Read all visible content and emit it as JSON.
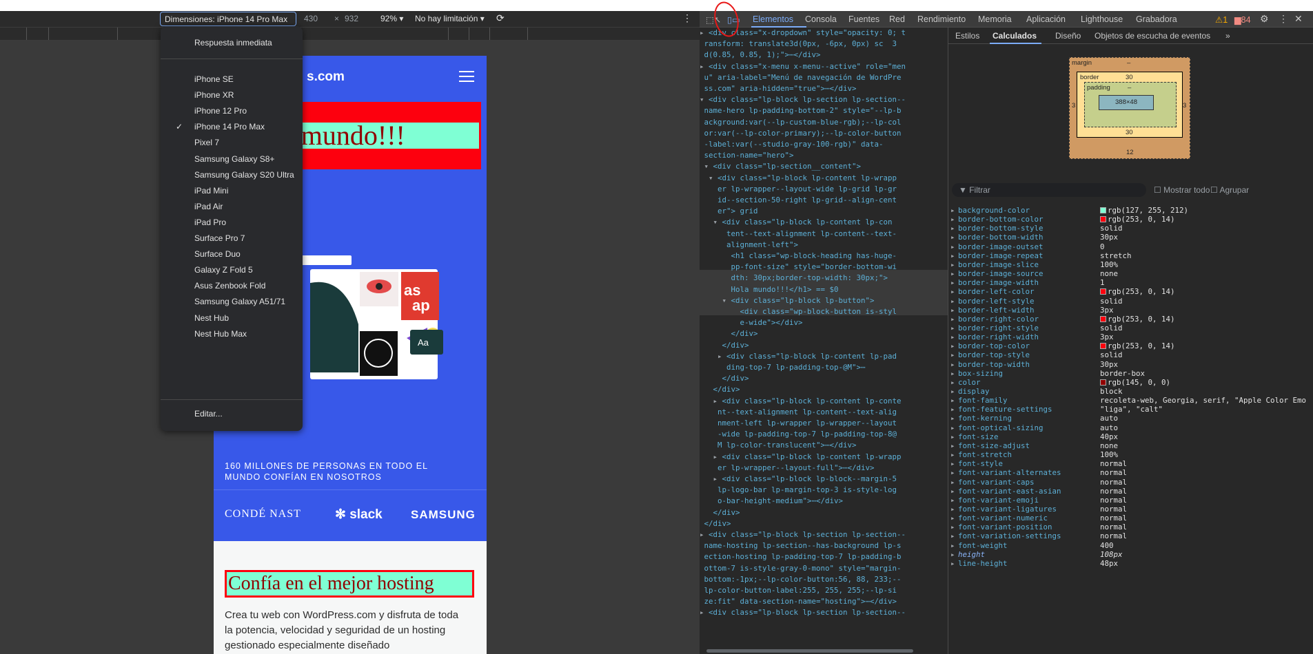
{
  "toolbar": {
    "dimensions_label": "Dimensiones: iPhone 14 Pro Max",
    "width": "430",
    "x": "×",
    "height": "932",
    "zoom": "92%",
    "throttle": "No hay limitación"
  },
  "menu": {
    "responsive": "Respuesta inmediata",
    "devices": [
      "iPhone SE",
      "iPhone XR",
      "iPhone 12 Pro",
      "iPhone 14 Pro Max",
      "Pixel 7",
      "Samsung Galaxy S8+",
      "Samsung Galaxy S20 Ultra",
      "iPad Mini",
      "iPad Air",
      "iPad Pro",
      "Surface Pro 7",
      "Surface Duo",
      "Galaxy Z Fold 5",
      "Asus Zenbook Fold",
      "Samsung Galaxy A51/71",
      "Nest Hub",
      "Nest Hub Max"
    ],
    "selected": "iPhone 14 Pro Max",
    "edit": "Editar..."
  },
  "site": {
    "logo": "s.com",
    "hero": "Hola mundo!!!",
    "trust": "160 MILLONES DE PERSONAS EN TODO EL MUNDO CONFÍAN EN NOSOTROS",
    "logos": [
      "CONDÉ NAST",
      "slack",
      "SAMSUNG"
    ],
    "host_heading": "Confía en el mejor hosting",
    "host_para": "Crea tu web con WordPress.com y disfruta de toda la potencia, velocidad y seguridad de un hosting gestionado especialmente diseñado"
  },
  "devtools": {
    "tabs": [
      "Elementos",
      "Consola",
      "Fuentes",
      "Red",
      "Rendimiento",
      "Memoria",
      "Aplicación",
      "Lighthouse",
      "Grabadora"
    ],
    "warn": "1",
    "msgs": "84"
  },
  "styles_tabs": [
    "Estilos",
    "Calculados",
    "Diseño",
    "Objetos de escucha de eventos"
  ],
  "boxmodel": {
    "margin": "margin",
    "margin_val": "–",
    "border": "border",
    "border_val": "30",
    "padding": "padding",
    "padding_val": "–",
    "content": "388×48",
    "side": "3",
    "bottom_margin": "12"
  },
  "filter": {
    "placeholder": "Filtrar",
    "show_all": "Mostrar todo",
    "group": "Agrupar"
  },
  "props": [
    {
      "n": "background-color",
      "v": "rgb(127, 255, 212)",
      "c": "#7fffd4"
    },
    {
      "n": "border-bottom-color",
      "v": "rgb(253, 0, 14)",
      "c": "#fd000e"
    },
    {
      "n": "border-bottom-style",
      "v": "solid"
    },
    {
      "n": "border-bottom-width",
      "v": "30px"
    },
    {
      "n": "border-image-outset",
      "v": "0"
    },
    {
      "n": "border-image-repeat",
      "v": "stretch"
    },
    {
      "n": "border-image-slice",
      "v": "100%"
    },
    {
      "n": "border-image-source",
      "v": "none"
    },
    {
      "n": "border-image-width",
      "v": "1"
    },
    {
      "n": "border-left-color",
      "v": "rgb(253, 0, 14)",
      "c": "#fd000e"
    },
    {
      "n": "border-left-style",
      "v": "solid"
    },
    {
      "n": "border-left-width",
      "v": "3px"
    },
    {
      "n": "border-right-color",
      "v": "rgb(253, 0, 14)",
      "c": "#fd000e"
    },
    {
      "n": "border-right-style",
      "v": "solid"
    },
    {
      "n": "border-right-width",
      "v": "3px"
    },
    {
      "n": "border-top-color",
      "v": "rgb(253, 0, 14)",
      "c": "#fd000e"
    },
    {
      "n": "border-top-style",
      "v": "solid"
    },
    {
      "n": "border-top-width",
      "v": "30px"
    },
    {
      "n": "box-sizing",
      "v": "border-box"
    },
    {
      "n": "color",
      "v": "rgb(145, 0, 0)",
      "c": "#910000"
    },
    {
      "n": "display",
      "v": "block"
    },
    {
      "n": "font-family",
      "v": "recoleta-web, Georgia, serif, \"Apple Color Emo"
    },
    {
      "n": "font-feature-settings",
      "v": "\"liga\", \"calt\""
    },
    {
      "n": "font-kerning",
      "v": "auto"
    },
    {
      "n": "font-optical-sizing",
      "v": "auto"
    },
    {
      "n": "font-size",
      "v": "40px"
    },
    {
      "n": "font-size-adjust",
      "v": "none"
    },
    {
      "n": "font-stretch",
      "v": "100%"
    },
    {
      "n": "font-style",
      "v": "normal"
    },
    {
      "n": "font-variant-alternates",
      "v": "normal"
    },
    {
      "n": "font-variant-caps",
      "v": "normal"
    },
    {
      "n": "font-variant-east-asian",
      "v": "normal"
    },
    {
      "n": "font-variant-emoji",
      "v": "normal"
    },
    {
      "n": "font-variant-ligatures",
      "v": "normal"
    },
    {
      "n": "font-variant-numeric",
      "v": "normal"
    },
    {
      "n": "font-variant-position",
      "v": "normal"
    },
    {
      "n": "font-variation-settings",
      "v": "normal"
    },
    {
      "n": "font-weight",
      "v": "400"
    },
    {
      "n": "height",
      "v": "108px",
      "i": true
    },
    {
      "n": "line-height",
      "v": "48px"
    }
  ],
  "code": [
    [
      "▸",
      "<div class=\"x-dropdown\" style=\"opacity: 0; t"
    ],
    [
      "",
      "ransform: translate3d(0px, -6px, 0px) sc  3"
    ],
    [
      "",
      "d(0.85, 0.85, 1);\">⋯</div>"
    ],
    [
      "▸",
      "<div class=\"x-menu x-menu--active\" role=\"men"
    ],
    [
      "",
      "u\" aria-label=\"Menú de navegación de WordPre"
    ],
    [
      "",
      "ss.com\" aria-hidden=\"true\">⋯</div>"
    ],
    [
      "▾",
      "<div class=\"lp-block lp-section lp-section--"
    ],
    [
      "",
      "name-hero lp-padding-bottom-2\" style=\"--lp-b"
    ],
    [
      "",
      "ackground:var(--lp-custom-blue-rgb);--lp-col"
    ],
    [
      "",
      "or:var(--lp-color-primary);--lp-color-button"
    ],
    [
      "",
      "-label:var(--studio-gray-100-rgb)\" data-"
    ],
    [
      "",
      "section-name=\"hero\">"
    ],
    [
      " ▾",
      "<div class=\"lp-section__content\">"
    ],
    [
      "  ▾",
      "<div class=\"lp-block lp-content lp-wrapp"
    ],
    [
      "",
      "   er lp-wrapper--layout-wide lp-grid lp-gr"
    ],
    [
      "",
      "   id--section-50-right lp-grid--align-cent"
    ],
    [
      "",
      "   er\"> grid"
    ],
    [
      "   ▾",
      "<div class=\"lp-block lp-content lp-con"
    ],
    [
      "",
      "     tent--text-alignment lp-content--text-"
    ],
    [
      "",
      "     alignment-left\">"
    ],
    [
      "",
      "      <h1 class=\"wp-block-heading has-huge-"
    ],
    [
      "",
      "      pp-font-size\" style=\"border-bottom-wi"
    ],
    [
      "",
      "      dth: 30px;border-top-width: 30px;\">"
    ],
    [
      "",
      "      Hola mundo!!!</h1> == $0"
    ],
    [
      "     ▾",
      "<div class=\"lp-block lp-button\">"
    ],
    [
      "",
      "        <div class=\"wp-block-button is-styl"
    ],
    [
      "",
      "        e-wide\"></div>"
    ],
    [
      "",
      "      </div>"
    ],
    [
      "",
      "    </div>"
    ],
    [
      "    ▸",
      "<div class=\"lp-block lp-content lp-pad"
    ],
    [
      "",
      "     ding-top-7 lp-padding-top-@M\">⋯"
    ],
    [
      "",
      "    </div>"
    ],
    [
      "",
      "  </div>"
    ],
    [
      "   ▸",
      "<div class=\"lp-block lp-content lp-conte"
    ],
    [
      "",
      "   nt--text-alignment lp-content--text-alig"
    ],
    [
      "",
      "   nment-left lp-wrapper lp-wrapper--layout"
    ],
    [
      "",
      "   -wide lp-padding-top-7 lp-padding-top-8@"
    ],
    [
      "",
      "   M lp-color-translucent\">⋯</div>"
    ],
    [
      "   ▸",
      "<div class=\"lp-block lp-content lp-wrapp"
    ],
    [
      "",
      "   er lp-wrapper--layout-full\">⋯</div>"
    ],
    [
      "   ▸",
      "<div class=\"lp-block lp-block--margin-5"
    ],
    [
      "",
      "   lp-logo-bar lp-margin-top-3 is-style-log"
    ],
    [
      "",
      "   o-bar-height-medium\">⋯</div>"
    ],
    [
      "",
      "  </div>"
    ],
    [
      "",
      "</div>"
    ],
    [
      "▸",
      "<div class=\"lp-block lp-section lp-section--"
    ],
    [
      "",
      "name-hosting lp-section--has-background lp-s"
    ],
    [
      "",
      "ection-hosting lp-padding-top-7 lp-padding-b"
    ],
    [
      "",
      "ottom-7 is-style-gray-0-mono\" style=\"margin-"
    ],
    [
      "",
      "bottom:-1px;--lp-color-button:56, 88, 233;--"
    ],
    [
      "",
      "lp-color-button-label:255, 255, 255;--lp-si"
    ],
    [
      "",
      "ze:fit\" data-section-name=\"hosting\">⋯</div>"
    ],
    [
      "▸",
      "<div class=\"lp-block lp-section lp-section--"
    ]
  ]
}
